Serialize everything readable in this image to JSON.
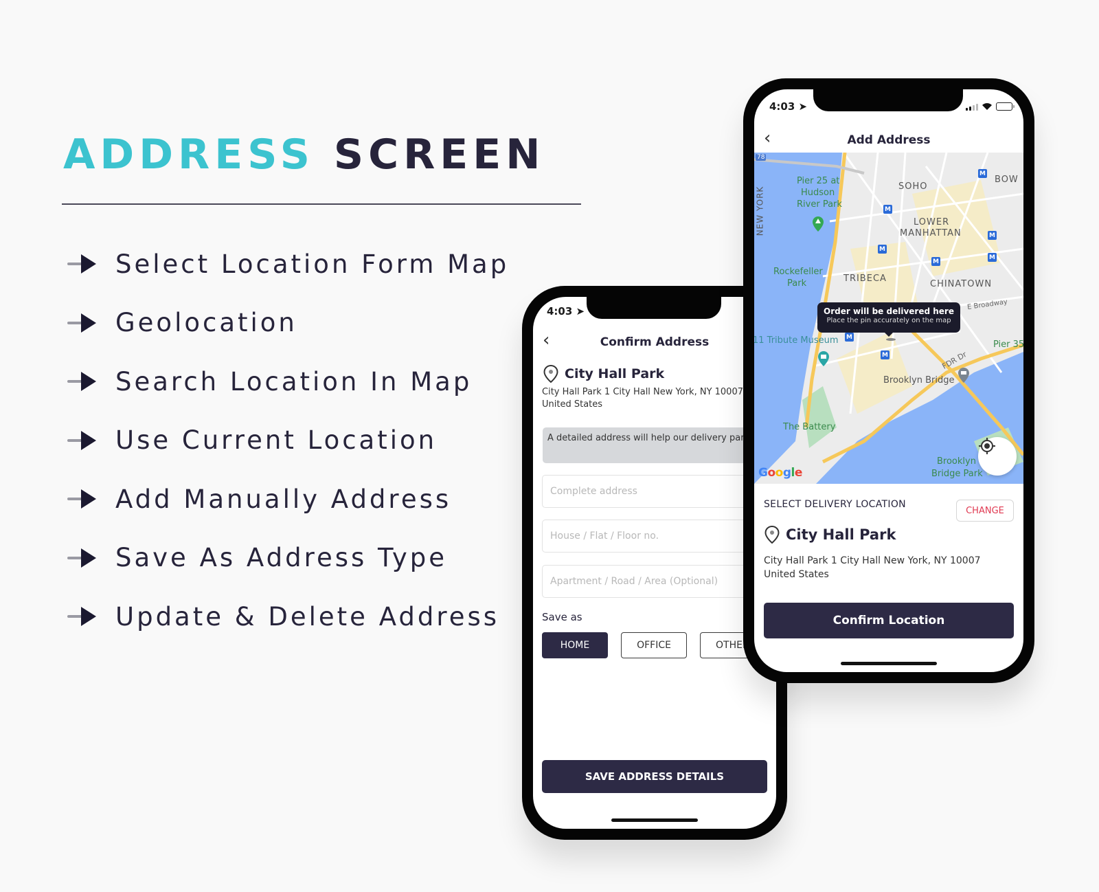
{
  "headline": {
    "accent": "ADDRESS",
    "rest": "SCREEN"
  },
  "colors": {
    "accent": "#3cc3cf",
    "dark": "#27243b",
    "button": "#2d2a45",
    "change": "#e03a52",
    "water": "#8ab4f8",
    "road": "#f6c85a"
  },
  "features": [
    "Select Location Form Map",
    "Geolocation",
    "Search Location In Map",
    "Use Current Location",
    "Add Manually Address",
    "Save As Address Type",
    "Update & Delete Address"
  ],
  "confirm_screen": {
    "status_time": "4:03",
    "title": "Confirm Address",
    "place_name": "City Hall Park",
    "address_line1": "City Hall Park 1 City Hall New York, NY  10007",
    "address_line2": "United States",
    "hint": "A detailed address will help our delivery parnter reach your doorstep easily",
    "fields": {
      "complete_address": {
        "value": "",
        "placeholder": "Complete address"
      },
      "house": {
        "value": "",
        "placeholder": "House / Flat / Floor no."
      },
      "apartment": {
        "value": "",
        "placeholder": "Apartment / Road / Area (Optional)"
      }
    },
    "save_as_label": "Save as",
    "address_types": [
      "HOME",
      "OFFICE",
      "OTHER"
    ],
    "selected_type": "HOME",
    "save_button": "SAVE ADDRESS DETAILS"
  },
  "add_screen": {
    "status_time": "4:03",
    "title": "Add Address",
    "map": {
      "labels": {
        "soho": "SOHO",
        "bowery": "BOW",
        "lower": "LOWER",
        "manhattan": "MANHATTAN",
        "tribeca": "TRIBECA",
        "chinatown": "CHINATOWN",
        "newyork": "NEW YORK",
        "pier25_1": "Pier 25 at",
        "pier25_2": "Hudson",
        "pier25_3": "River Park",
        "rockefeller_1": "Rockefeller",
        "rockefeller_2": "Park",
        "tribute": "11 Tribute Museum",
        "brooklyn_bridge": "Brooklyn Bridge",
        "battery": "The Battery",
        "bbpark_1": "Brooklyn",
        "bbpark_2": "Bridge Park",
        "ebroadway": "E Broadway",
        "fdr": "FDR Dr",
        "pier35": "Pier 35",
        "route": "78"
      },
      "tooltip_title": "Order will be delivered here",
      "tooltip_subtitle": "Place the pin accurately on the map",
      "attribution": "Google"
    },
    "select_label": "SELECT DELIVERY LOCATION",
    "change_button": "CHANGE",
    "place_name": "City Hall Park",
    "address_line1": "City Hall Park 1 City Hall New York, NY  10007",
    "address_line2": "United States",
    "confirm_button": "Confirm Location"
  }
}
